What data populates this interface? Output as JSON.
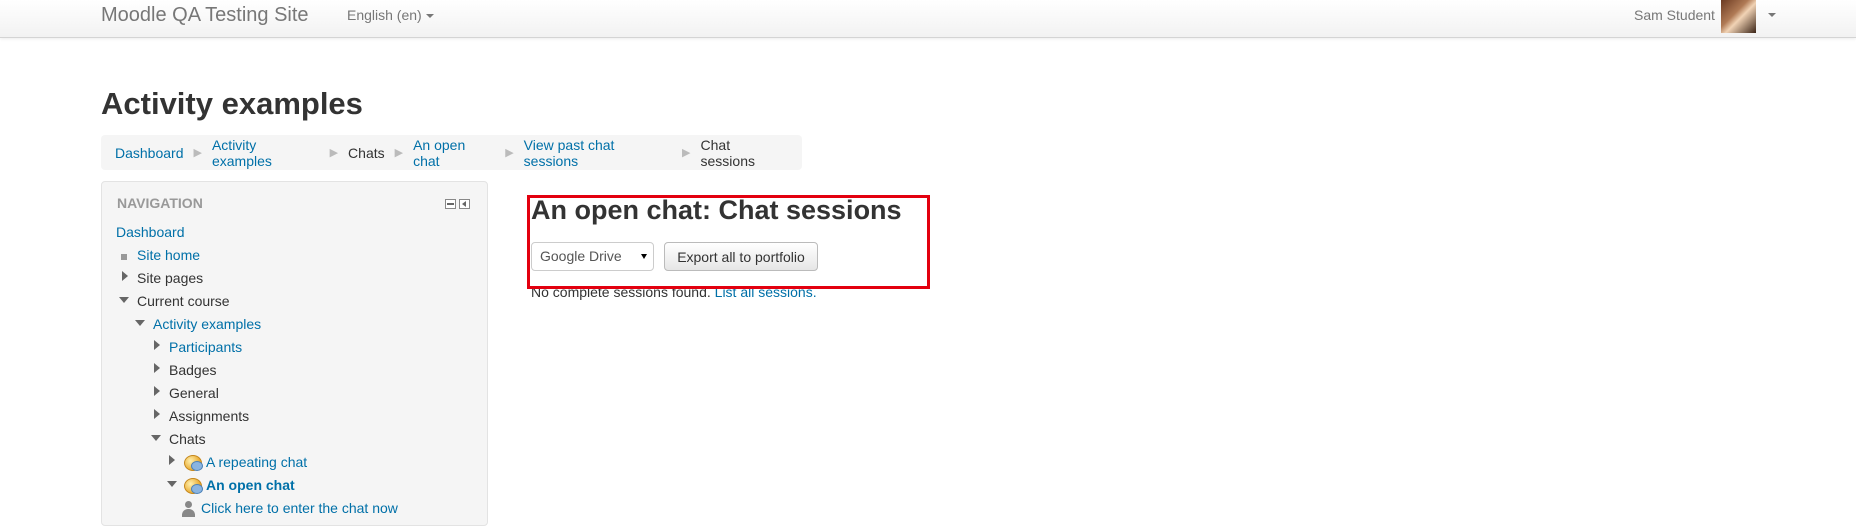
{
  "navbar": {
    "brand": "Moodle QA Testing Site",
    "language": "English (en)",
    "user_name": "Sam Student"
  },
  "page": {
    "title": "Activity examples"
  },
  "breadcrumb": [
    {
      "label": "Dashboard",
      "link": true
    },
    {
      "label": "Activity examples",
      "link": true
    },
    {
      "label": "Chats",
      "link": false
    },
    {
      "label": "An open chat",
      "link": true
    },
    {
      "label": "View past chat sessions",
      "link": true
    },
    {
      "label": "Chat sessions",
      "link": false
    }
  ],
  "navigation": {
    "header": "NAVIGATION",
    "items": [
      {
        "label": "Dashboard"
      },
      {
        "label": "Site home"
      },
      {
        "label": "Site pages"
      },
      {
        "label": "Current course"
      },
      {
        "label": "Activity examples"
      },
      {
        "label": "Participants"
      },
      {
        "label": "Badges"
      },
      {
        "label": "General"
      },
      {
        "label": "Assignments"
      },
      {
        "label": "Chats"
      },
      {
        "label": "A repeating chat"
      },
      {
        "label": "An open chat"
      },
      {
        "label": "Click here to enter the chat now"
      }
    ]
  },
  "main": {
    "heading": "An open chat: Chat sessions",
    "portfolio_select": "Google Drive",
    "export_button": "Export all to portfolio",
    "no_sessions_text": "No complete sessions found.",
    "list_all_link": "List all sessions."
  },
  "colors": {
    "link": "#0070a8",
    "highlight": "#e3000f"
  }
}
